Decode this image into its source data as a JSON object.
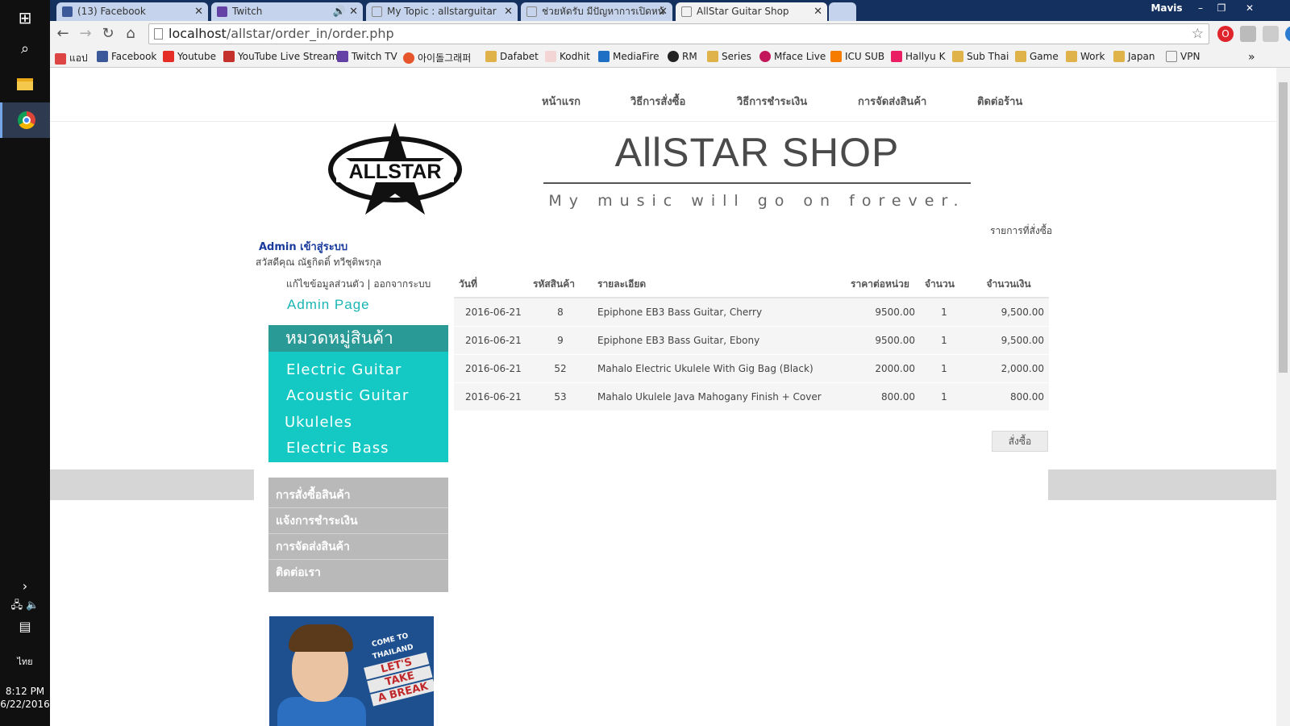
{
  "taskbar": {
    "time": "8:12 PM",
    "date": "6/22/2016",
    "language": "ไทย"
  },
  "window": {
    "user": "Mavis"
  },
  "tabs": [
    {
      "label": "(13) Facebook",
      "color": "#3b5998"
    },
    {
      "label": "Twitch",
      "color": "#6441a5"
    },
    {
      "label": "My Topic : allstarguitar",
      "color": "#888888"
    },
    {
      "label": "ช่วยหัดรับ มีปัญหาการเปิดหน้",
      "color": "#888888"
    },
    {
      "label": "AllStar Guitar Shop",
      "color": "#888888"
    }
  ],
  "address": {
    "host": "localhost",
    "path": "/allstar/order_in/order.php"
  },
  "bookmarks": [
    {
      "label": "แอป",
      "color": "#d44"
    },
    {
      "label": "Facebook",
      "color": "#3b5998"
    },
    {
      "label": "Youtube",
      "color": "#e52d27"
    },
    {
      "label": "YouTube Live Stream",
      "color": "#c4302b"
    },
    {
      "label": "Twitch TV",
      "color": "#6441a5"
    },
    {
      "label": "아이돌그래퍼",
      "color": "#e5542b"
    },
    {
      "label": "Dafabet",
      "color": "#e0b34a"
    },
    {
      "label": "Kodhit",
      "color": "#d66"
    },
    {
      "label": "MediaFire",
      "color": "#1f6fc5"
    },
    {
      "label": "RM",
      "color": "#222"
    },
    {
      "label": "Series",
      "color": "#e0b34a"
    },
    {
      "label": "Mface Live",
      "color": "#c2185b"
    },
    {
      "label": "ICU SUB",
      "color": "#f57c00"
    },
    {
      "label": "Hallyu K",
      "color": "#e91e63"
    },
    {
      "label": "Sub Thai",
      "color": "#e0b34a"
    },
    {
      "label": "Game",
      "color": "#e0b34a"
    },
    {
      "label": "Work",
      "color": "#e0b34a"
    },
    {
      "label": "Japan",
      "color": "#e0b34a"
    },
    {
      "label": "VPN",
      "color": "#888"
    }
  ],
  "site": {
    "nav": [
      "หน้าแรก",
      "วิธีการสั่งซื้อ",
      "วิธีการชำระเงิน",
      "การจัดส่งสินค้า",
      "ติดต่อร้าน"
    ],
    "brand": "AllSTAR SHOP",
    "slogan": "My music will go on forever.",
    "logo_text": "ALLSTAR",
    "breadcrumb": "รายการที่สั่งซื้อ",
    "admin_label": "Admin เข้าสู่ระบบ",
    "greeting": "สวัสดีคุณ  ณัฐกิตติ์ ทวีชุติพรกุล",
    "account_links": "แก้ไขข้อมูลส่วนตัว | ออกจากระบบ",
    "admin_page": "Admin Page",
    "category_title": "หมวดหมู่สินค้า",
    "categories": [
      "Electric Guitar",
      "Acoustic Guitar",
      "Ukuleles",
      "Electric Bass"
    ],
    "side_menu": [
      "การสั่งซื้อสินค้า",
      "แจ้งการชำระเงิน",
      "การจัดส่งสินค้า",
      "ติดต่อเรา"
    ],
    "promo_text": [
      "COME TO THAILAND",
      "LET'S",
      "TAKE",
      "A BREAK"
    ],
    "buy_button": "สั่งซื้อ"
  },
  "orders": {
    "headers": [
      "วันที่",
      "รหัสสินค้า",
      "รายละเอียด",
      "ราคาต่อหน่วย",
      "จำนวน",
      "จำนวนเงิน"
    ],
    "rows": [
      {
        "date": "2016-06-21",
        "id": "8",
        "detail": "Epiphone EB3 Bass Guitar, Cherry",
        "price": "9500.00",
        "qty": "1",
        "total": "9,500.00"
      },
      {
        "date": "2016-06-21",
        "id": "9",
        "detail": "Epiphone EB3 Bass Guitar, Ebony",
        "price": "9500.00",
        "qty": "1",
        "total": "9,500.00"
      },
      {
        "date": "2016-06-21",
        "id": "52",
        "detail": "Mahalo Electric Ukulele With Gig Bag (Black)",
        "price": "2000.00",
        "qty": "1",
        "total": "2,000.00"
      },
      {
        "date": "2016-06-21",
        "id": "53",
        "detail": "Mahalo Ukulele Java Mahogany Finish + Cover",
        "price": "800.00",
        "qty": "1",
        "total": "800.00"
      }
    ]
  }
}
